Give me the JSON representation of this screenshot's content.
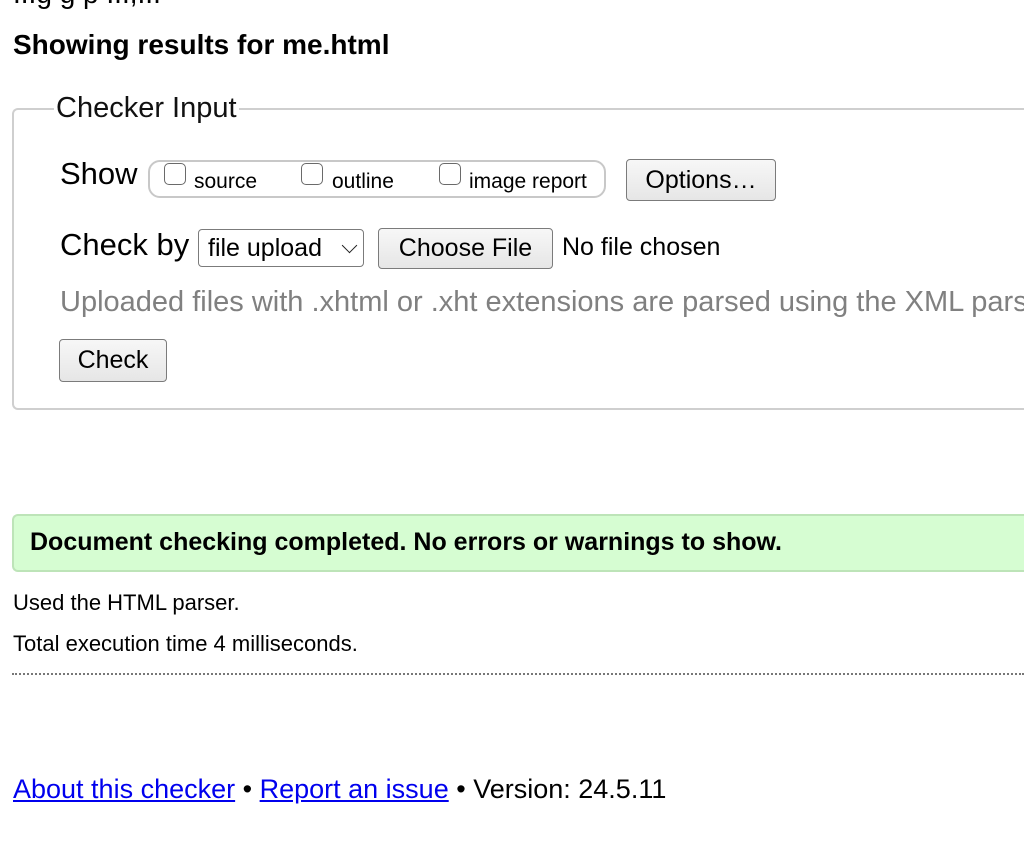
{
  "intro": {
    "cutoff_text": "...g g p ...,..."
  },
  "results": {
    "heading": "Showing results for me.html"
  },
  "checker_input": {
    "legend": "Checker Input",
    "show_label": "Show",
    "show_options": [
      {
        "label": "source",
        "checked": false
      },
      {
        "label": "outline",
        "checked": false
      },
      {
        "label": "image report",
        "checked": false
      }
    ],
    "options_button": "Options…",
    "check_by_label": "Check by",
    "check_by_selected": "file upload",
    "choose_file_button": "Choose File",
    "no_file_text": "No file chosen",
    "hint": "Uploaded files with .xhtml or .xht extensions are parsed using the XML parser.",
    "check_button": "Check"
  },
  "status": {
    "success_message": "Document checking completed. No errors or warnings to show."
  },
  "details": {
    "parser": "Used the HTML parser.",
    "execution_time": "Total execution time 4 milliseconds."
  },
  "footer": {
    "about_link": "About this checker",
    "separator": "•",
    "report_link": "Report an issue",
    "version": "Version: 24.5.11"
  },
  "colors": {
    "success_bg": "#d6fdd2",
    "link": "#0000ee",
    "hint": "#808080"
  }
}
